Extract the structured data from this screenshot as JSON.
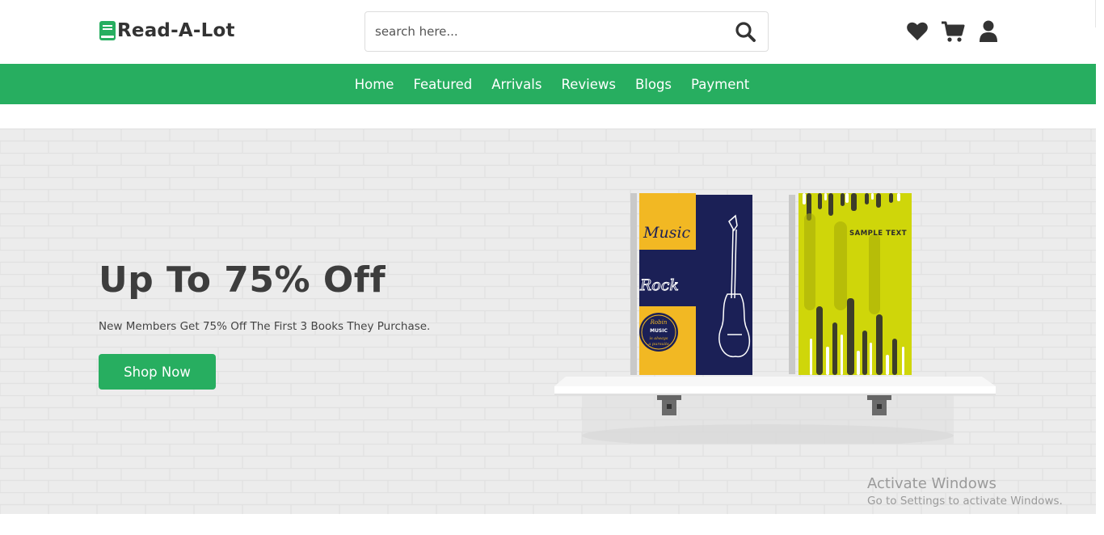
{
  "header": {
    "logo_text": "Read-A-Lot",
    "search_placeholder": "search here...",
    "icons": [
      "heart-icon",
      "cart-icon",
      "user-icon"
    ]
  },
  "nav": {
    "items": [
      "Home",
      "Featured",
      "Arrivals",
      "Reviews",
      "Blogs",
      "Payment"
    ]
  },
  "hero": {
    "title": "Up To 75% Off",
    "subtitle": "New Members Get 75% Off The First 3 Books They Purchase.",
    "button_label": "Shop Now",
    "book1": {
      "word1": "Music",
      "word2": "Rock",
      "badge_lines": [
        "Robin",
        "MUSIC",
        "is always",
        "a pursuits"
      ]
    },
    "book2": {
      "text": "SAMPLE TEXT"
    }
  },
  "watermark": {
    "title": "Activate Windows",
    "subtitle": "Go to Settings to activate Windows."
  },
  "colors": {
    "brand_green": "#27ae60",
    "book_yellow": "#f2b823",
    "book_navy": "#1b2056",
    "book_lime": "#cfd60a",
    "text_dark": "#3d3d3d"
  }
}
